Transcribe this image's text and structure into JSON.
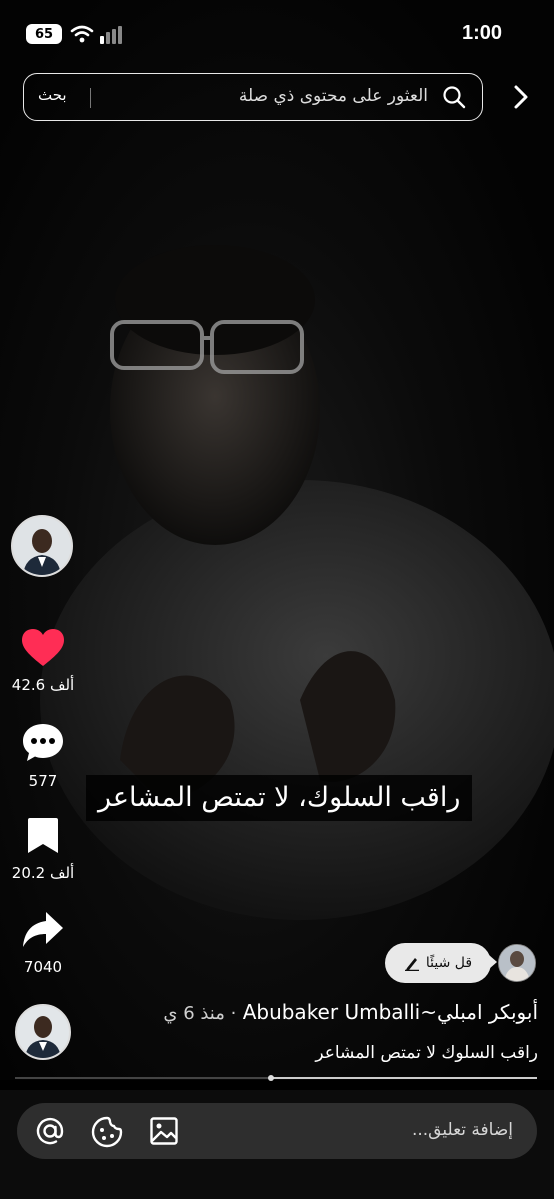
{
  "status_bar": {
    "battery": "65",
    "time": "1:00"
  },
  "search": {
    "placeholder": "العثور على محتوى ذي صلة",
    "button_label": "بحث"
  },
  "rail": {
    "likes": "42.6 ألف",
    "comments": "577",
    "bookmarks": "20.2 ألف",
    "shares": "7040"
  },
  "caption": "راقب السلوك، لا تمتص المشاعر",
  "say_something": "قل شيئًا",
  "author": {
    "name": "أبوبكر امبلي~Abubaker Umballi",
    "time_ago": "· منذ 6 ي",
    "description": "راقب السلوك لا تمتص المشاعر"
  },
  "video": {
    "progress": 0.49
  },
  "comment_bar": {
    "placeholder": "إضافة تعليق..."
  },
  "colors": {
    "like_red": "#ff2d55",
    "background": "#000000"
  }
}
